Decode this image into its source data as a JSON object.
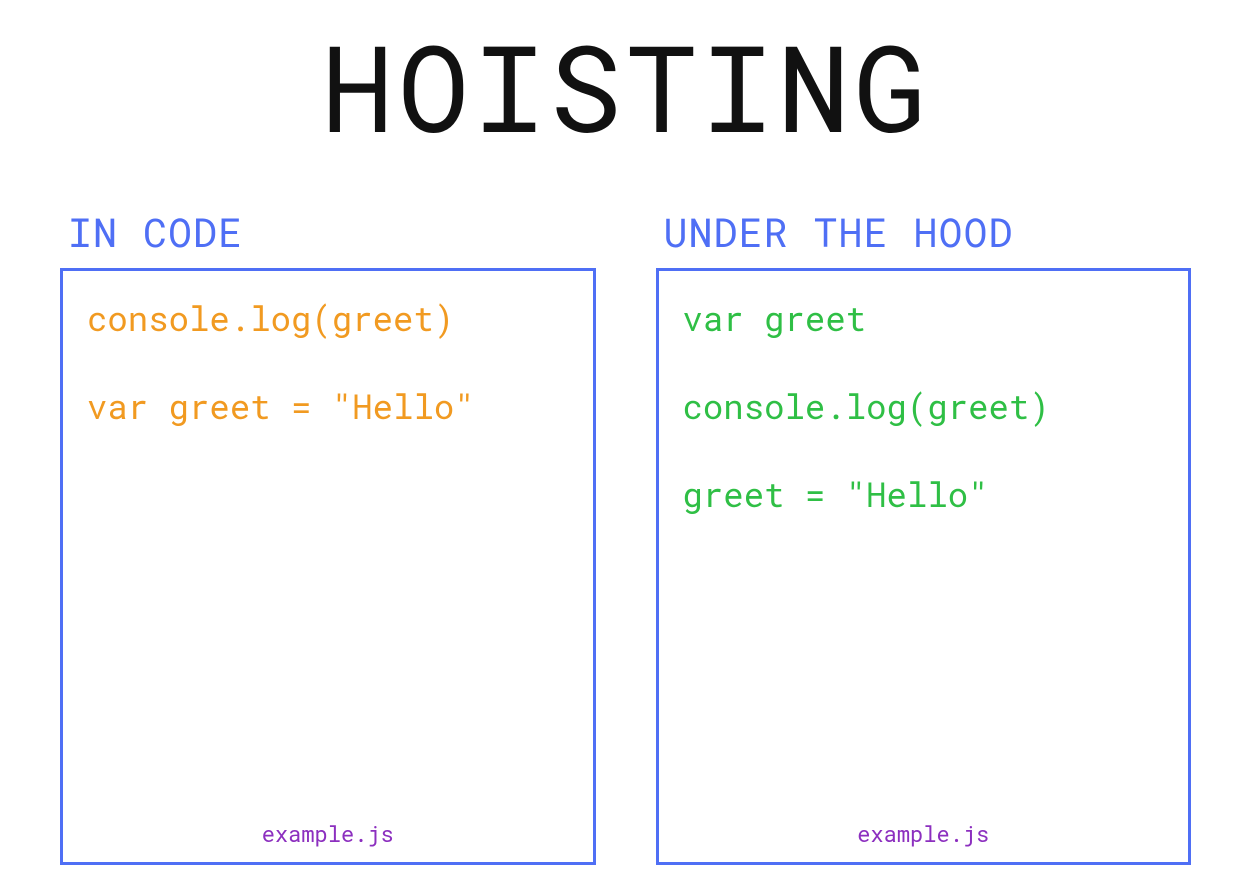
{
  "title": "HOISTING",
  "left": {
    "heading": "IN CODE",
    "lines": [
      "console.log(greet)",
      "var greet = \"Hello\""
    ],
    "filename": "example.js"
  },
  "right": {
    "heading": "UNDER THE HOOD",
    "lines": [
      "var greet",
      "console.log(greet)",
      "greet = \"Hello\""
    ],
    "filename": "example.js"
  }
}
